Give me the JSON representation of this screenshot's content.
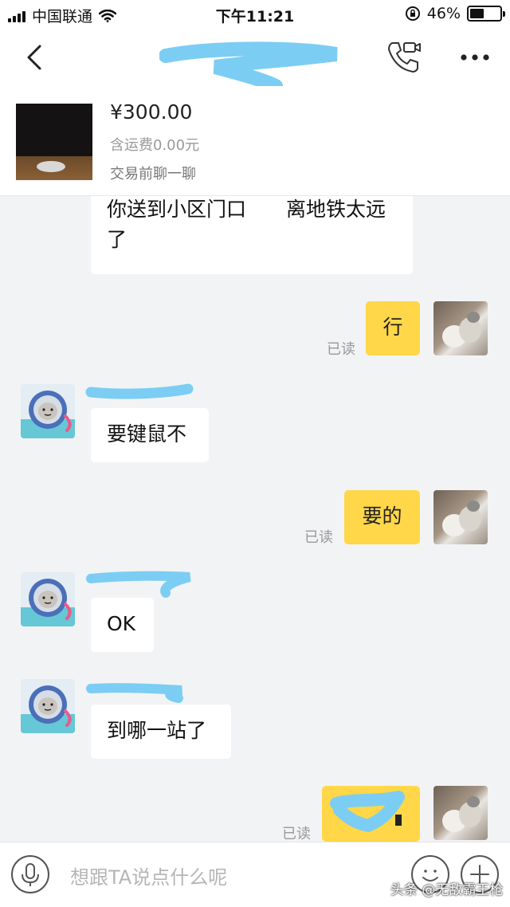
{
  "status_bar": {
    "carrier": "中国联通",
    "time": "下午11:21",
    "battery": "46%",
    "battery_level": 0.46
  },
  "nav": {
    "back_icon": "chevron-left-icon",
    "call_icon": "phone-video-icon",
    "more_icon": "more-dots-icon"
  },
  "product": {
    "price": "¥300.00",
    "shipping": "含运费0.00元",
    "action": "交易前聊一聊"
  },
  "messages": {
    "m1": "你送到小区门口　　离地铁太远了",
    "m2": "行",
    "m3": "要键鼠不",
    "m4": "要的",
    "m5": "OK",
    "m6": "到哪一站了"
  },
  "read_label": "已读",
  "input": {
    "placeholder": "想跟TA说点什么呢",
    "voice_icon": "microphone-icon",
    "emoji_icon": "smiley-icon",
    "plus_icon": "plus-icon"
  },
  "watermark": "头条 @无敌霸王枪",
  "colors": {
    "outgoing_bubble": "#ffd748",
    "incoming_bubble": "#ffffff",
    "redaction_mark": "#7ccdf3"
  }
}
